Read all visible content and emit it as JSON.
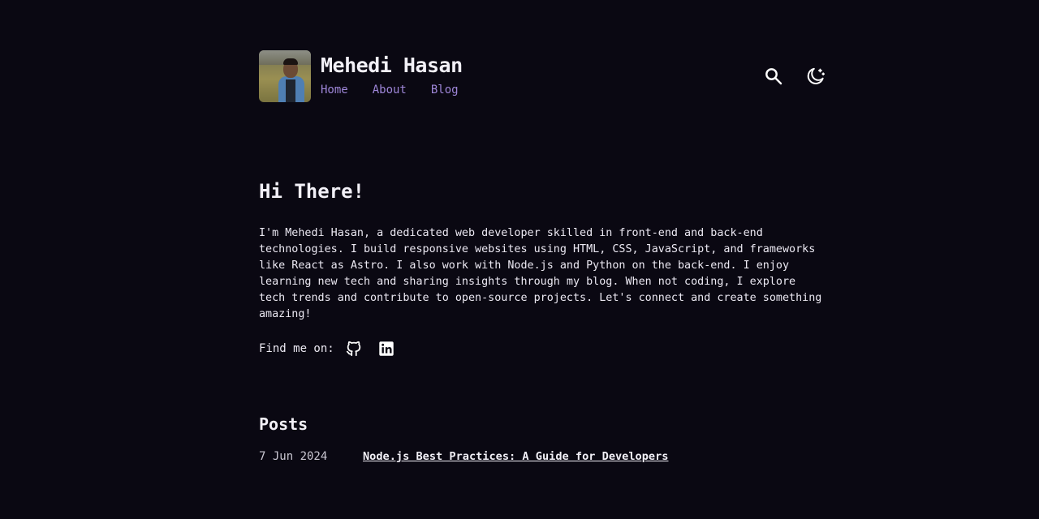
{
  "header": {
    "site_title": "Mehedi Hasan",
    "nav": [
      "Home",
      "About",
      "Blog"
    ],
    "icons": {
      "search": "search-icon",
      "theme": "moon-icon"
    }
  },
  "hero": {
    "title": "Hi There!",
    "bio": "I'm Mehedi Hasan, a dedicated web developer skilled in front-end and back-end technologies. I build responsive websites using HTML, CSS, JavaScript, and frameworks like React as Astro. I also work with Node.js and Python on the back-end. I enjoy learning new tech and sharing insights through my blog. When not coding, I explore tech trends and contribute to open-source projects. Let's connect and create something amazing!",
    "find_me_label": "Find me on:",
    "social_icons": [
      "github-icon",
      "linkedin-icon"
    ]
  },
  "posts": {
    "title": "Posts",
    "items": [
      {
        "date": "7 Jun 2024",
        "title": "Node.js Best Practices: A Guide for Developers"
      }
    ]
  },
  "colors": {
    "background": "#0a0812",
    "text": "#e9e7ef",
    "accent": "#9e86d8"
  }
}
